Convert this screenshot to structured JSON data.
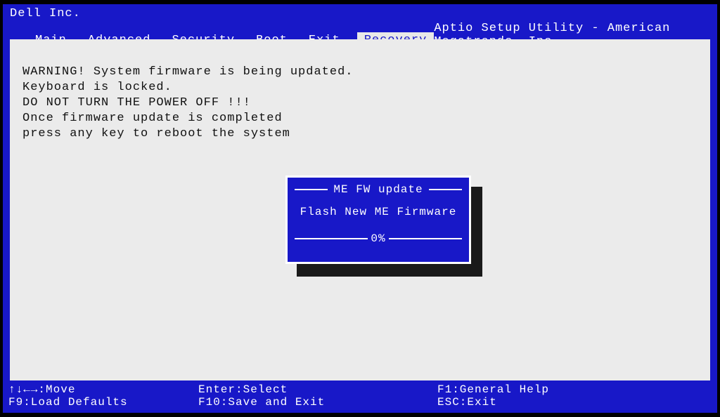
{
  "vendor": "Dell Inc.",
  "utility_title": "Aptio Setup Utility - American Megatrends, Inc.",
  "tabs": {
    "main": "Main",
    "advanced": "Advanced",
    "security": "Security",
    "boot": "Boot",
    "exit": "Exit",
    "recovery": "Recovery"
  },
  "active_tab": "recovery",
  "warning": {
    "line1": "WARNING! System firmware is being updated.",
    "line2": "Keyboard is locked.",
    "line3": "DO NOT TURN THE POWER OFF !!!",
    "line4": "Once firmware update is completed",
    "line5": "press any key to reboot the system"
  },
  "dialog": {
    "title": "ME FW update",
    "body": "Flash New ME Firmware",
    "progress": "0%"
  },
  "footer": {
    "move": "↑↓←→:Move",
    "select": "Enter:Select",
    "help": "F1:General Help",
    "defaults": "F9:Load Defaults",
    "save": "F10:Save and Exit",
    "esc": "ESC:Exit"
  }
}
